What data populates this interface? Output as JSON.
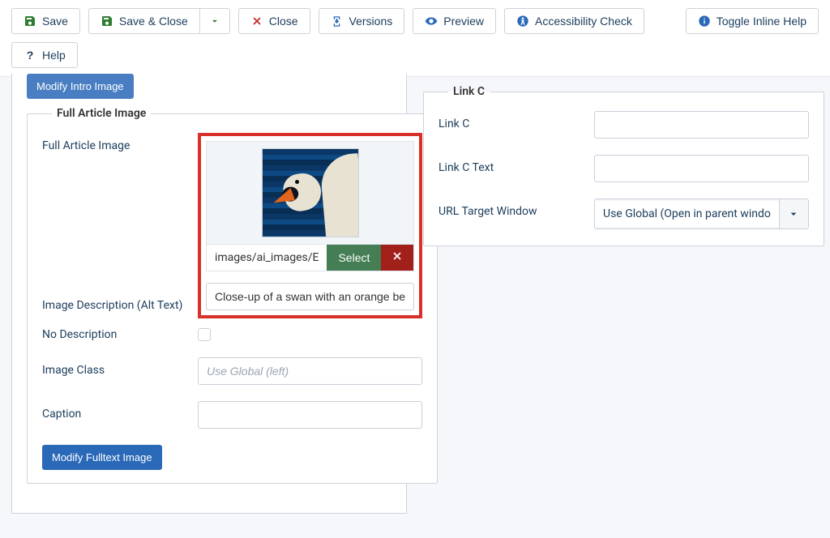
{
  "toolbar": {
    "save": "Save",
    "save_close": "Save & Close",
    "close": "Close",
    "versions": "Versions",
    "preview": "Preview",
    "accessibility": "Accessibility Check",
    "toggle_help": "Toggle Inline Help",
    "help": "Help"
  },
  "left": {
    "modify_intro": "Modify Intro Image",
    "fieldset_title": "Full Article Image",
    "labels": {
      "full_image": "Full Article Image",
      "alt_text": "Image Description (Alt Text)",
      "no_desc": "No Description",
      "image_class": "Image Class",
      "caption": "Caption"
    },
    "image_path": "images/ai_images/E",
    "select_btn": "Select",
    "alt_value": "Close-up of a swan with an orange bea",
    "image_class_placeholder": "Use Global (left)",
    "modify_full": "Modify Fulltext Image"
  },
  "right": {
    "fieldset_title": "Link C",
    "labels": {
      "link": "Link C",
      "link_text": "Link C Text",
      "target": "URL Target Window"
    },
    "target_value": "Use Global (Open in parent windo"
  }
}
